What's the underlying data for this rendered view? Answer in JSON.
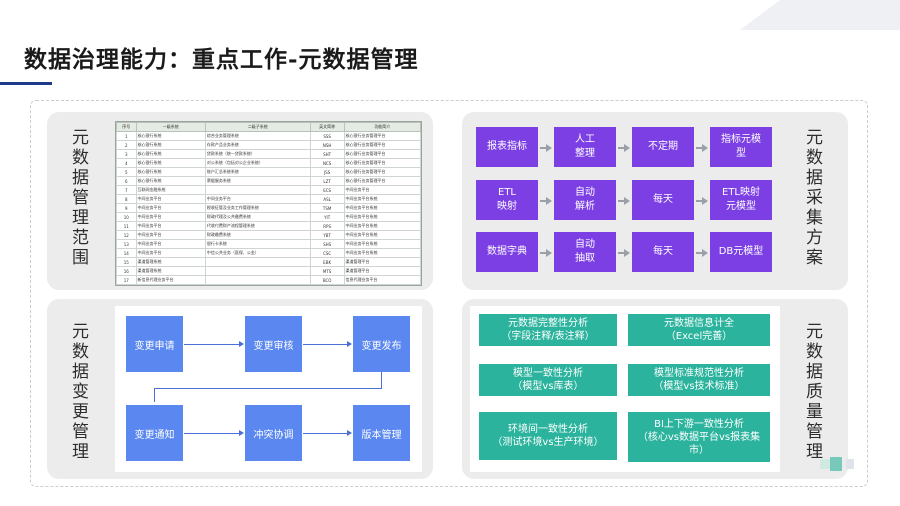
{
  "page": {
    "title": "数据治理能力：重点工作-元数据管理"
  },
  "panels": {
    "scope_label": "元数据管理范围",
    "collect_label": "元数据采集方案",
    "change_label": "元数据变更管理",
    "quality_label": "元数据质量管理"
  },
  "collect": {
    "rows": [
      [
        "报表指标",
        "人工\n整理",
        "不定期",
        "指标元模\n型"
      ],
      [
        "ETL\n映射",
        "自动\n解析",
        "每天",
        "ETL映射\n元模型"
      ],
      [
        "数据字典",
        "自动\n抽取",
        "每天",
        "DB元模型"
      ]
    ]
  },
  "change": {
    "apply": "变更申请",
    "review": "变更审核",
    "publish": "变更发布",
    "notify": "变更通知",
    "conflict": "冲突协调",
    "version": "版本管理"
  },
  "quality": {
    "items": [
      "元数据完整性分析\n（字段注释/表注释）",
      "元数据信息计全\n（Excel完善）",
      "模型一致性分析\n（模型vs库表）",
      "模型标准规范性分析\n（模型vs技术标准）",
      "环境间一致性分析\n（测试环境vs生产环境）",
      "BI上下游一致性分析\n（核心vs数据平台vs报表集\n市）"
    ]
  },
  "table": {
    "headers": [
      "序号",
      "一级系统",
      "二级子系统",
      "英文简称",
      "功能简介"
    ],
    "rows": [
      [
        "1",
        "核心银行系统",
        "综合业务管理系统",
        "SSS",
        "核心银行业务管理平台"
      ],
      [
        "2",
        "核心银行系统",
        "存款产品业务系统",
        "NSH",
        "核心银行业务管理平台"
      ],
      [
        "3",
        "核心银行系统",
        "贷款系统（统一贷款系统）",
        "SHT",
        "核心银行业务管理平台"
      ],
      [
        "4",
        "核心银行系统",
        "对公系统（包括对公企业系统）",
        "NCS",
        "核心银行业务管理平台"
      ],
      [
        "5",
        "核心银行系统",
        "账户汇总系统系统",
        "JSS",
        "核心银行业务管理平台"
      ],
      [
        "6",
        "核心银行系统",
        "票据服务系统",
        "LZT",
        "核心银行业务管理平台"
      ],
      [
        "7",
        "互联网金融系统",
        "",
        "ECS",
        "中间业务平台"
      ],
      [
        "8",
        "中间业务平台",
        "中间业务平台",
        "ASL",
        "中间业务平台系统"
      ],
      [
        "9",
        "中间业务平台",
        "税收征管及业务工作管理系统",
        "TSM",
        "中间业务平台系统"
      ],
      [
        "10",
        "中间业务平台",
        "财政代理及公共缴费系统",
        "YIT",
        "中间业务平台系统"
      ],
      [
        "11",
        "中间业务平台",
        "代收付费财产流程管理系统",
        "RPS",
        "中间业务平台系统"
      ],
      [
        "12",
        "中间业务平台",
        "财政缴费系统",
        "YBT",
        "中间业务平台系统"
      ],
      [
        "13",
        "中间业务平台",
        "银行卡系统",
        "SHS",
        "中间业务平台系统"
      ],
      [
        "14",
        "中间业务平台",
        "中信公共业务（医保、公金）",
        "CSC",
        "中间业务平台系统"
      ],
      [
        "15",
        "渠道管理系统",
        "",
        "EBK",
        "渠道管理平台"
      ],
      [
        "16",
        "渠道管理系统",
        "",
        "MTS",
        "渠道管理平台"
      ],
      [
        "17",
        "新信息代理业务平台",
        "",
        "BCO",
        "信息代理业务平台"
      ],
      [
        "18",
        "数据管理系统",
        "",
        "CMS",
        "数据管理系统平台"
      ]
    ]
  }
}
